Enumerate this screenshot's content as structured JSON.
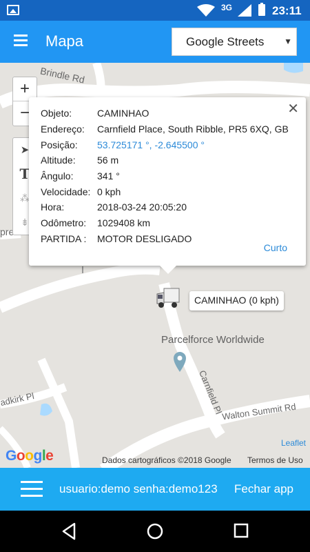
{
  "status_bar": {
    "network": "3G",
    "time": "23:11"
  },
  "app_bar": {
    "title": "Mapa",
    "map_type": "Google Streets"
  },
  "map": {
    "roads": [
      "Brindle Rd",
      "Carnfield Pl",
      "Walton Summit Rd",
      "adkirk Pl",
      "presc"
    ],
    "poi": "Parcelforce Worldwide",
    "attribution": {
      "leaflet": "Leaflet",
      "google": "Google",
      "map_data": "Dados cartográficos ©2018 Google",
      "terms": "Termos de Uso"
    }
  },
  "popup": {
    "rows": [
      {
        "label": "Objeto:",
        "value": "CAMINHAO"
      },
      {
        "label": "Endereço:",
        "value": "Carnfield Place, South Ribble, PR5 6XQ, GB"
      },
      {
        "label": "Posição:",
        "value": "53.725171 °, -2.645500 °"
      },
      {
        "label": "Altitude:",
        "value": "56 m"
      },
      {
        "label": "Ângulo:",
        "value": "341 °"
      },
      {
        "label": "Velocidade:",
        "value": "0 kph"
      },
      {
        "label": "Hora:",
        "value": "2018-03-24 20:05:20"
      },
      {
        "label": "Odômetro:",
        "value": "1029408 km"
      },
      {
        "label": "PARTIDA :",
        "value": "MOTOR DESLIGADO"
      }
    ],
    "short_link": "Curto"
  },
  "vehicle": {
    "label": "CAMINHAO (0 kph)"
  },
  "bottom_bar": {
    "credentials": "usuario:demo senha:demo123",
    "close_app": "Fechar app"
  },
  "colors": {
    "status_bar": "#1565c0",
    "app_bar": "#2196f3",
    "bottom_bar": "#1eaaf1",
    "link": "#2b8ad8"
  }
}
